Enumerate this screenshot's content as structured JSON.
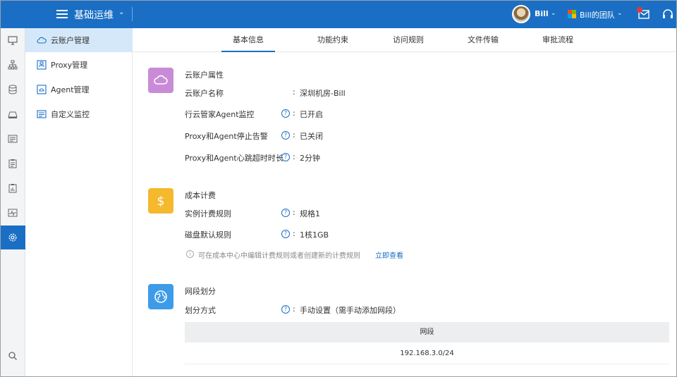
{
  "header": {
    "app_title": "基础运维",
    "user_name": "Bill",
    "team_name": "Bill的团队",
    "brand_color": "#1a6fc4"
  },
  "rail": {
    "items": [
      {
        "icon": "monitor-icon"
      },
      {
        "icon": "topology-icon"
      },
      {
        "icon": "database-icon"
      },
      {
        "icon": "server-icon"
      },
      {
        "icon": "list-icon"
      },
      {
        "icon": "clipboard-icon"
      },
      {
        "icon": "report-icon"
      },
      {
        "icon": "pulse-icon"
      },
      {
        "icon": "gear-icon",
        "active": true
      },
      {
        "icon": "search-icon"
      }
    ]
  },
  "sidebar": {
    "items": [
      {
        "label": "云账户管理",
        "icon": "cloud-icon",
        "active": true
      },
      {
        "label": "Proxy管理",
        "icon": "proxy-icon"
      },
      {
        "label": "Agent管理",
        "icon": "agent-icon"
      },
      {
        "label": "自定义监控",
        "icon": "custom-monitor-icon"
      }
    ]
  },
  "tabs": [
    {
      "label": "基本信息",
      "active": true
    },
    {
      "label": "功能约束"
    },
    {
      "label": "访问规则"
    },
    {
      "label": "文件传输"
    },
    {
      "label": "审批流程"
    }
  ],
  "account": {
    "title": "云账户属性",
    "fields": [
      {
        "label": "云账户名称",
        "value": "深圳机房-Bill"
      },
      {
        "label": "行云管家Agent监控",
        "value": "已开启"
      },
      {
        "label": "Proxy和Agent停止告警",
        "value": "已关闭"
      },
      {
        "label": "Proxy和Agent心跳超时时长",
        "value": "2分钟"
      }
    ]
  },
  "cost": {
    "title": "成本计费",
    "fields": [
      {
        "label": "实例计费规则",
        "value": "规格1"
      },
      {
        "label": "磁盘默认规则",
        "value": "1核1GB"
      }
    ],
    "hint": "可在成本中心中编辑计费规则或者创建新的计费规则",
    "hint_link": "立即查看"
  },
  "network": {
    "title": "网段划分",
    "fields": [
      {
        "label": "划分方式",
        "value": "手动设置（需手动添加网段）"
      }
    ],
    "table_header": "网段",
    "rows": [
      "192.168.3.0/24"
    ]
  },
  "colon": ":",
  "colors": {
    "account_icon": "#c98bd8",
    "cost_icon": "#f5b92e",
    "network_icon": "#3d9be9"
  }
}
